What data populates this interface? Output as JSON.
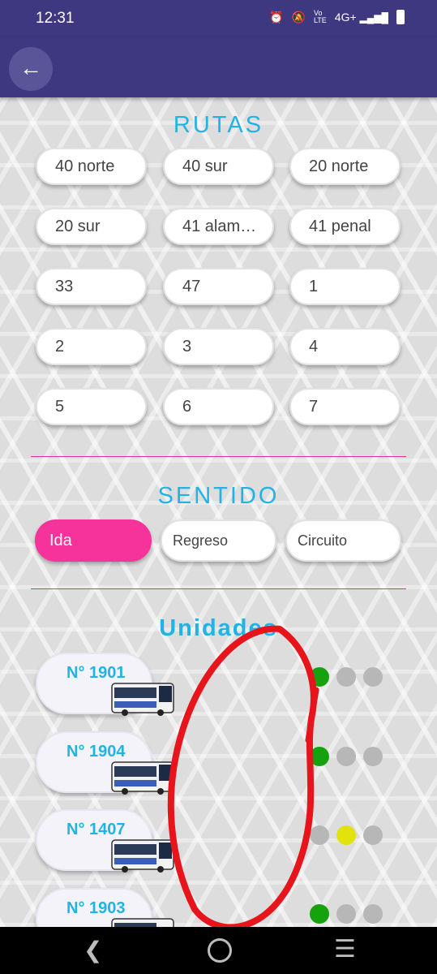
{
  "status_bar": {
    "time": "12:31",
    "icons": [
      "alarm-icon",
      "mute-icon",
      "volte-icon",
      "signal-4g-icon",
      "battery-icon"
    ],
    "network_label": "4G+"
  },
  "app_bar": {
    "back_icon": "arrow-left-icon"
  },
  "routes": {
    "title": "RUTAS",
    "items": [
      "40 norte",
      "40 sur",
      "20 norte",
      "20 sur",
      "41 alam…",
      "41 penal",
      "33",
      "47",
      "1",
      "2",
      "3",
      "4",
      "5",
      "6",
      "7"
    ]
  },
  "direction": {
    "title": "SENTIDO",
    "options": [
      "Ida",
      "Regreso",
      "Circuito"
    ],
    "selected": "Ida"
  },
  "units": {
    "title": "Unidades",
    "items": [
      {
        "label": "N° 1901",
        "lights": [
          "green",
          "gray",
          "gray"
        ]
      },
      {
        "label": "N° 1904",
        "lights": [
          "green",
          "gray",
          "gray"
        ]
      },
      {
        "label": "N° 1407",
        "lights": [
          "gray",
          "yellow",
          "gray"
        ]
      },
      {
        "label": "N° 1903",
        "lights": [
          "green",
          "gray",
          "gray"
        ]
      }
    ]
  },
  "colors": {
    "primary": "#3d3880",
    "accent": "#21b3e6",
    "selected_chip": "#f5339a",
    "divider": "#e0308f",
    "light_green": "#16a20f",
    "light_yellow": "#e2e20d",
    "light_off": "#b7b7b7",
    "annotation_red": "#e8141c"
  },
  "nav_bar": {
    "icons": [
      "back-nav-icon",
      "home-nav-icon",
      "recents-nav-icon"
    ]
  }
}
